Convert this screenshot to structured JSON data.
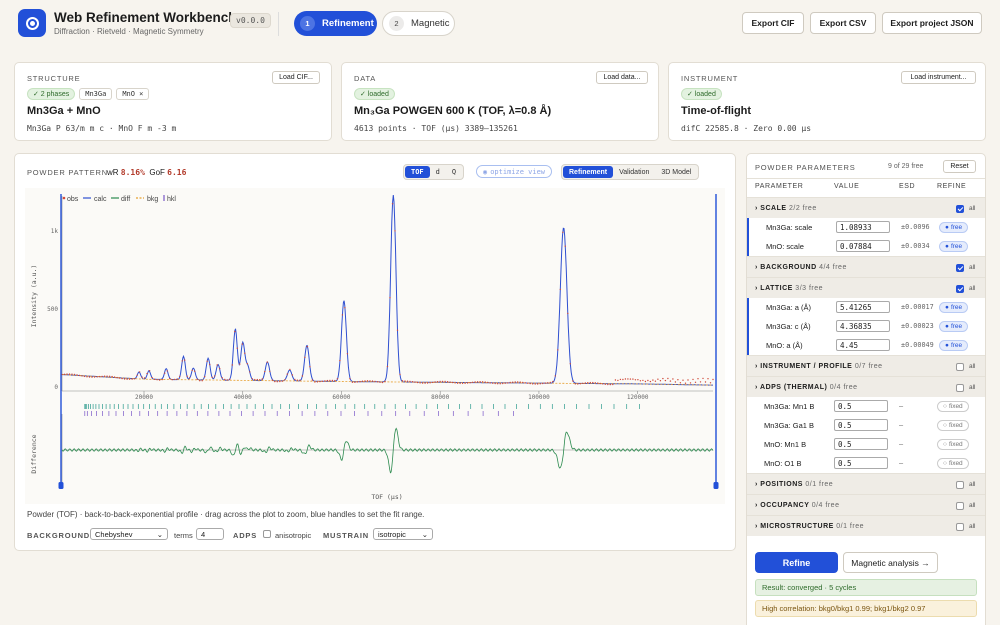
{
  "app": {
    "title": "Web Refinement Workbench",
    "version": "v0.0.0",
    "subtitle": "Diffraction · Rietveld · Magnetic Symmetry"
  },
  "steps": [
    {
      "num": "1",
      "label": "Refinement",
      "active": true
    },
    {
      "num": "2",
      "label": "Magnetic",
      "active": false
    }
  ],
  "header_buttons": [
    "Export CIF",
    "Export CSV",
    "Export project JSON"
  ],
  "structure": {
    "label": "STRUCTURE",
    "load_button": "Load CIF...",
    "phase_badge": "✓ 2 phases",
    "phases": [
      "Mn3Ga",
      "MnO ×"
    ],
    "title": "Mn3Ga + MnO",
    "desc": "Mn3Ga P 63/m m c · MnO F m -3 m"
  },
  "data_card": {
    "label": "DATA",
    "load_button": "Load data...",
    "status": "✓ loaded",
    "title": "Mn₃Ga POWGEN 600 K (TOF, λ=0.8 Å)",
    "desc": "4613 points · TOF (μs) 3389–135261"
  },
  "instrument": {
    "label": "INSTRUMENT",
    "load_button": "Load instrument...",
    "status": "✓ loaded",
    "title": "Time-of-flight",
    "desc": "difC 22585.8 · Zero 0.00 μs"
  },
  "pattern": {
    "label": "POWDER PATTERN",
    "wr_label": "wR",
    "wr_value": "8.16%",
    "gof_label": "GoF",
    "gof_value": "6.16",
    "axis_modes": [
      "TOF",
      "d",
      "Q"
    ],
    "optimize": "optimize view",
    "views": [
      "Refinement",
      "Validation",
      "3D Model"
    ],
    "legend": [
      "obs",
      "calc",
      "diff",
      "bkg",
      "hkl"
    ],
    "y_label": "Intensity (a.u.)",
    "diff_label": "Difference",
    "x_label": "TOF (μs)",
    "footnote": "Powder (TOF) · back-to-back-exponential profile · drag across the plot to zoom, blue handles to set the fit range.",
    "background_label": "BACKGROUND",
    "background_value": "Chebyshev",
    "terms_label": "terms",
    "terms_value": "4",
    "adps_label": "ADPS",
    "anisotropic": "anisotropic",
    "mustrain_label": "MUSTRAIN",
    "mustrain_value": "isotropic"
  },
  "chart_data": {
    "type": "line",
    "xlabel": "TOF (μs)",
    "ylabel": "Intensity (a.u.)",
    "x_ticks": [
      "20000",
      "40000",
      "60000",
      "80000",
      "100000",
      "120000"
    ],
    "y_ticks": [
      "0",
      "500",
      "1k"
    ],
    "xlim": [
      3389,
      135261
    ],
    "ylim": [
      0,
      1200
    ],
    "series": [
      {
        "name": "obs",
        "color": "#d04a3a"
      },
      {
        "name": "calc",
        "color": "#2f4fd0"
      },
      {
        "name": "diff",
        "color": "#2b8a4e"
      },
      {
        "name": "bkg",
        "color": "#e7a030"
      },
      {
        "name": "hkl",
        "color": "#7a56c8"
      }
    ],
    "peaks": [
      {
        "x": 19000,
        "y": 45
      },
      {
        "x": 21000,
        "y": 55
      },
      {
        "x": 24500,
        "y": 70
      },
      {
        "x": 28000,
        "y": 150
      },
      {
        "x": 30000,
        "y": 75
      },
      {
        "x": 33000,
        "y": 140
      },
      {
        "x": 35000,
        "y": 100
      },
      {
        "x": 38500,
        "y": 330
      },
      {
        "x": 40000,
        "y": 240
      },
      {
        "x": 41000,
        "y": 90
      },
      {
        "x": 45000,
        "y": 120
      },
      {
        "x": 49500,
        "y": 70
      },
      {
        "x": 53000,
        "y": 230
      },
      {
        "x": 60500,
        "y": 520
      },
      {
        "x": 70500,
        "y": 1200
      },
      {
        "x": 105000,
        "y": 1000
      }
    ],
    "background_curve": [
      [
        3389,
        80
      ],
      [
        20000,
        50
      ],
      [
        60000,
        35
      ],
      [
        120000,
        20
      ],
      [
        135261,
        12
      ]
    ]
  },
  "params": {
    "title": "POWDER PARAMETERS",
    "free_count": "9 of 29 free",
    "reset": "Reset",
    "columns": [
      "PARAMETER",
      "VALUE",
      "ESD",
      "REFINE"
    ],
    "all_label": "all",
    "groups": [
      {
        "name": "SCALE",
        "count": "2/2 free",
        "checked": true,
        "rows": [
          {
            "name": "Mn3Ga: scale",
            "value": "1.08933",
            "esd": "±0.0096",
            "state": "free"
          },
          {
            "name": "MnO: scale",
            "value": "0.07884",
            "esd": "±0.0034",
            "state": "free"
          }
        ]
      },
      {
        "name": "BACKGROUND",
        "count": "4/4 free",
        "checked": true,
        "rows": []
      },
      {
        "name": "LATTICE",
        "count": "3/3 free",
        "checked": true,
        "rows": [
          {
            "name": "Mn3Ga: a (Å)",
            "value": "5.41265",
            "esd": "±0.00017",
            "state": "free"
          },
          {
            "name": "Mn3Ga: c (Å)",
            "value": "4.36835",
            "esd": "±0.00023",
            "state": "free"
          },
          {
            "name": "MnO: a (Å)",
            "value": "4.45",
            "esd": "±0.00049",
            "state": "free"
          }
        ]
      },
      {
        "name": "INSTRUMENT / PROFILE",
        "count": "0/7 free",
        "checked": false,
        "rows": []
      },
      {
        "name": "ADPS (THERMAL)",
        "count": "0/4 free",
        "checked": false,
        "rows": [
          {
            "name": "Mn3Ga: Mn1 B",
            "value": "0.5",
            "esd": "—",
            "state": "fixed"
          },
          {
            "name": "Mn3Ga: Ga1 B",
            "value": "0.5",
            "esd": "—",
            "state": "fixed"
          },
          {
            "name": "MnO: Mn1 B",
            "value": "0.5",
            "esd": "—",
            "state": "fixed"
          },
          {
            "name": "MnO: O1 B",
            "value": "0.5",
            "esd": "—",
            "state": "fixed"
          }
        ]
      },
      {
        "name": "POSITIONS",
        "count": "0/1 free",
        "checked": false,
        "rows": []
      },
      {
        "name": "OCCUPANCY",
        "count": "0/4 free",
        "checked": false,
        "rows": []
      },
      {
        "name": "MICROSTRUCTURE",
        "count": "0/1 free",
        "checked": false,
        "rows": []
      }
    ],
    "free_label": "free",
    "fixed_label": "fixed",
    "refine": "Refine",
    "magnetic": "Magnetic analysis →",
    "result": "Result: converged · 5 cycles",
    "warning": "High correlation: bkg0/bkg1 0.99; bkg1/bkg2 0.97"
  }
}
